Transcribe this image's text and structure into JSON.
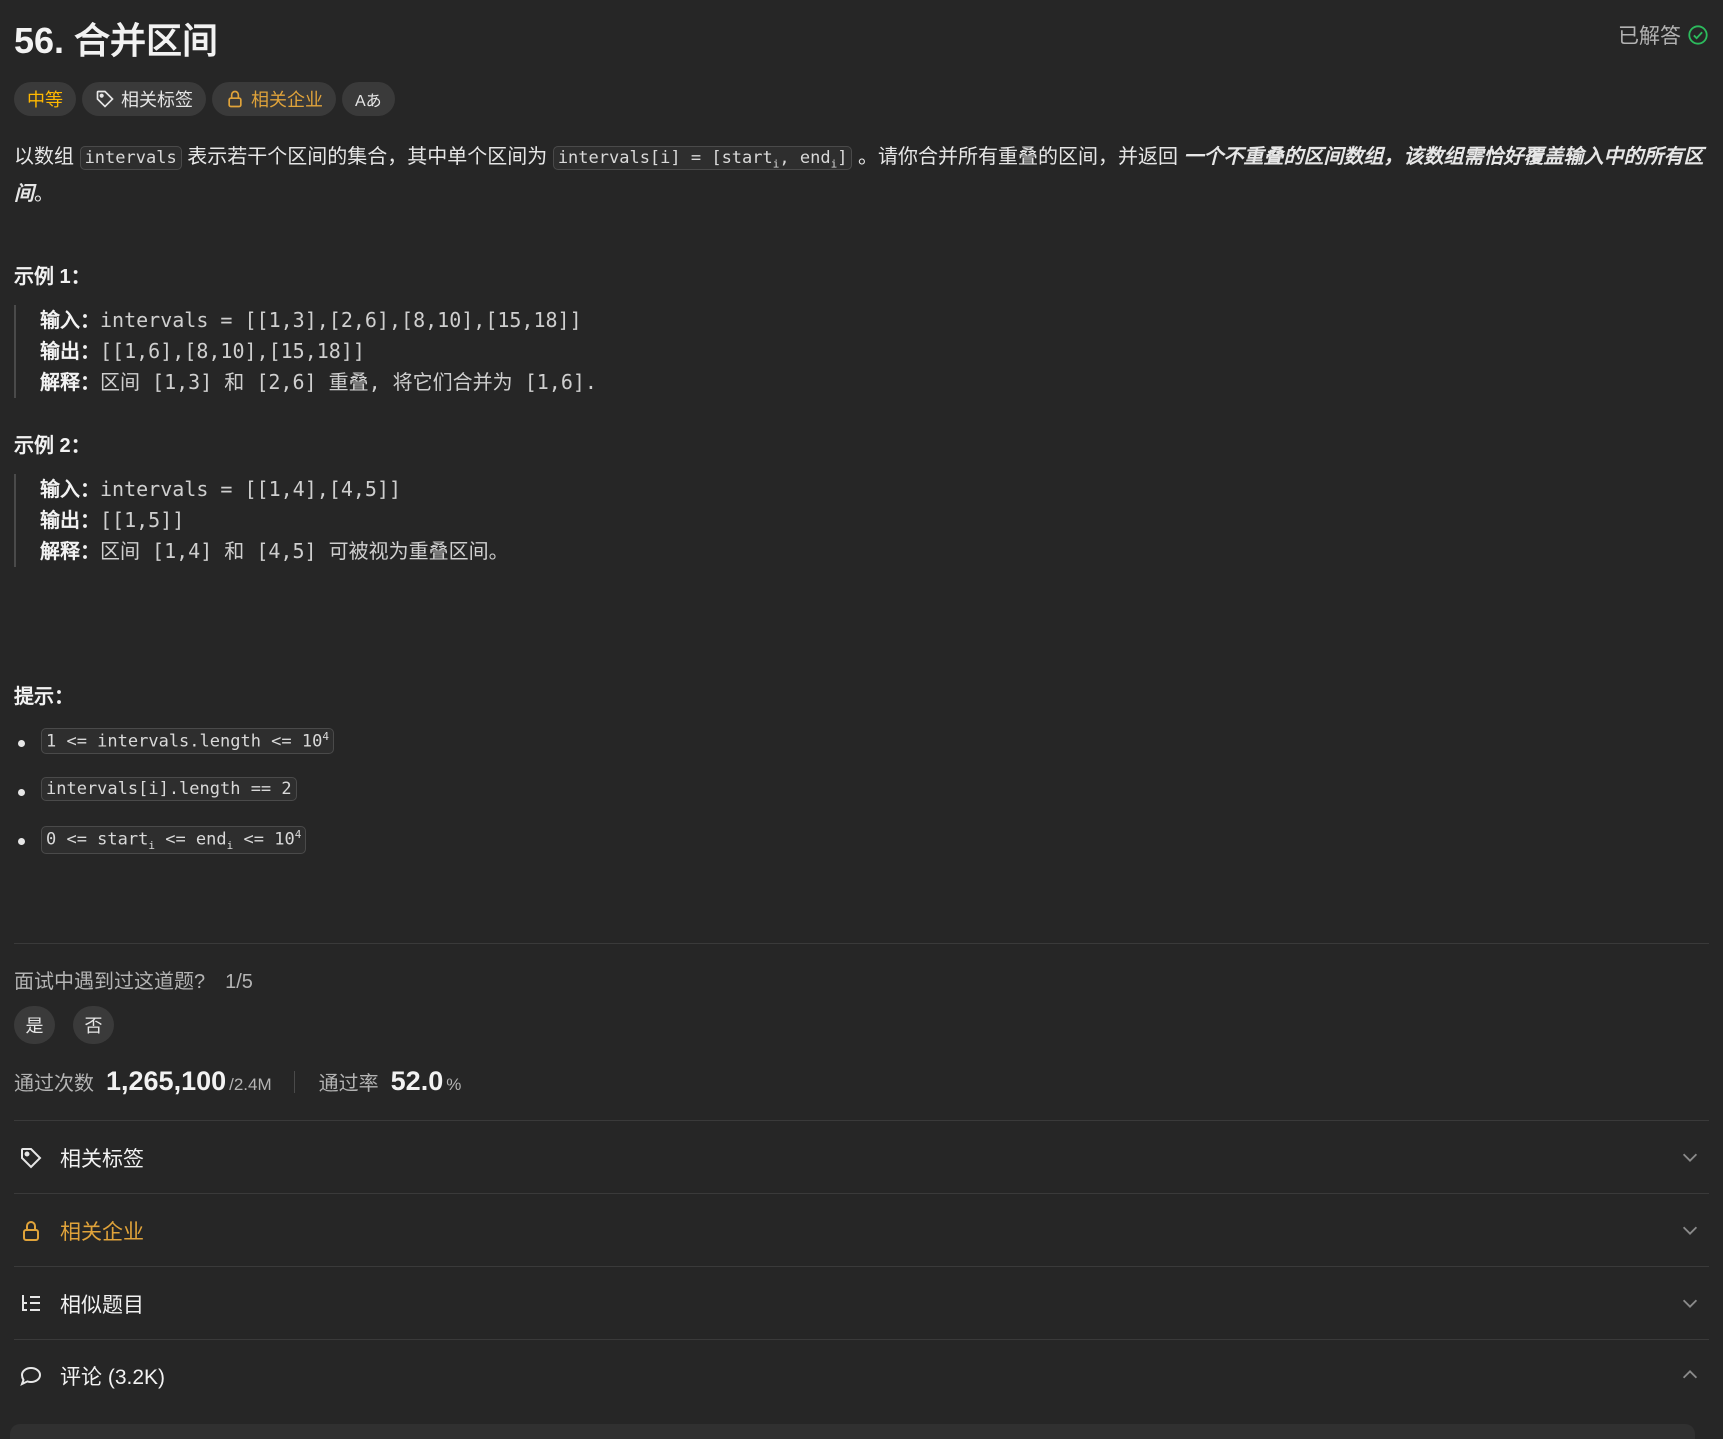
{
  "header": {
    "title": "56. 合并区间",
    "status": "已解答"
  },
  "tags": {
    "difficulty": "中等",
    "topics": "相关标签",
    "companies": "相关企业",
    "translate": "Aあ"
  },
  "description": {
    "p1": "以数组",
    "code1": "intervals",
    "p2": "表示若干个区间的集合，其中单个区间为",
    "code2_a": "intervals[i] = [start",
    "code2_sub1": "i",
    "code2_b": ", end",
    "code2_sub2": "i",
    "code2_c": "]",
    "p3": "。请你合并所有重叠的区间，并返回",
    "emph": "一个不重叠的区间数组，该数组需恰好覆盖输入中的所有区间",
    "p4": "。"
  },
  "examples": [
    {
      "heading": "示例 1：",
      "input_label": "输入：",
      "input": "intervals = [[1,3],[2,6],[8,10],[15,18]]",
      "output_label": "输出：",
      "output": "[[1,6],[8,10],[15,18]]",
      "explain_label": "解释：",
      "explain": "区间 [1,3] 和 [2,6] 重叠, 将它们合并为 [1,6]."
    },
    {
      "heading": "示例 2：",
      "input_label": "输入：",
      "input": "intervals = [[1,4],[4,5]]",
      "output_label": "输出：",
      "output": "[[1,5]]",
      "explain_label": "解释：",
      "explain": "区间 [1,4] 和 [4,5] 可被视为重叠区间。"
    }
  ],
  "hints": {
    "heading": "提示：",
    "h1_a": "1 <= intervals.length <= 10",
    "h1_sup": "4",
    "h2": "intervals[i].length == 2",
    "h3_a": "0 <= start",
    "h3_sub1": "i",
    "h3_b": " <= end",
    "h3_sub2": "i",
    "h3_c": " <= 10",
    "h3_sup": "4"
  },
  "interview": {
    "question": "面试中遇到过这道题?",
    "count": "1/5",
    "yes": "是",
    "no": "否"
  },
  "stats": {
    "accepted_label": "通过次数",
    "accepted": "1,265,100",
    "submissions": "/2.4M",
    "rate_label": "通过率",
    "rate": "52.0",
    "rate_unit": "%"
  },
  "accordion": {
    "topics": "相关标签",
    "companies": "相关企业",
    "similar": "相似题目",
    "comments": "评论 (3.2K)"
  },
  "colors": {
    "background": "#262626",
    "difficulty": "#ffb800",
    "company": "#e0a33a",
    "solved_check": "#2cbb5d"
  }
}
